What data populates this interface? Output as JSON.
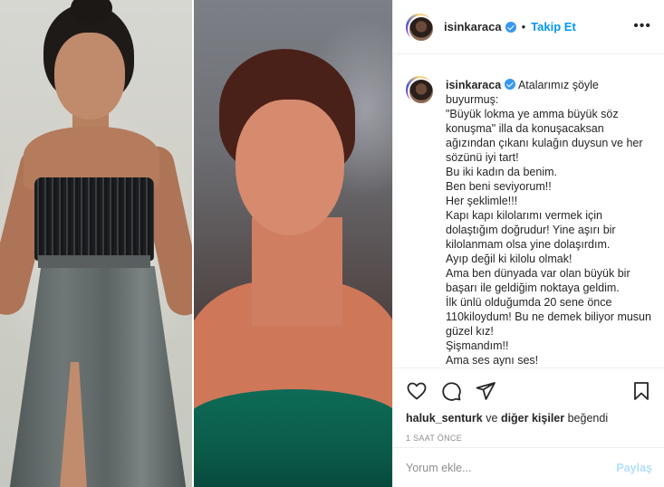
{
  "header": {
    "username": "isinkaraca",
    "separator": "•",
    "follow_label": "Takip Et",
    "more_label": "•••"
  },
  "caption": {
    "username": "isinkaraca",
    "lines": [
      "Atalarımız şöyle buyurmuş:",
      "\"Büyük lokma ye amma büyük söz konuşma\" illa da konuşacaksan ağızından çıkanı kulağın duysun ve her sözünü iyi tart!",
      "Bu iki kadın da benim.",
      "Ben beni seviyorum!!",
      "Her şeklimle!!!",
      "Kapı kapı kilolarımı vermek için dolaştığım doğrudur! Yine aşırı bir kilolanmam olsa yine dolaşırdım.",
      "Ayıp değil ki kilolu olmak!",
      "Ama ben dünyada var olan büyük bir başarı ile geldiğim noktaya geldim.",
      "İlk ünlü olduğumda 20 sene önce 110kiloydum! Bu ne demek biliyor musun güzel kız!",
      "Şişmandım!!",
      "Ama ses aynı ses!"
    ]
  },
  "actions": {
    "like_icon": "heart-icon",
    "comment_icon": "comment-icon",
    "share_icon": "paper-plane-icon",
    "save_icon": "bookmark-icon"
  },
  "likes": {
    "first_user": "haluk_senturk",
    "connector": "ve",
    "others": "diğer kişiler",
    "suffix": "beğendi"
  },
  "timestamp": "1 SAAT ÖNCE",
  "comment": {
    "placeholder": "Yorum ekle...",
    "submit_label": "Paylaş"
  },
  "colors": {
    "accent": "#0095f6",
    "verified": "#3897f0",
    "submit_disabled": "#b2dffc",
    "divider": "#efefef",
    "muted": "#8e8e8e"
  }
}
